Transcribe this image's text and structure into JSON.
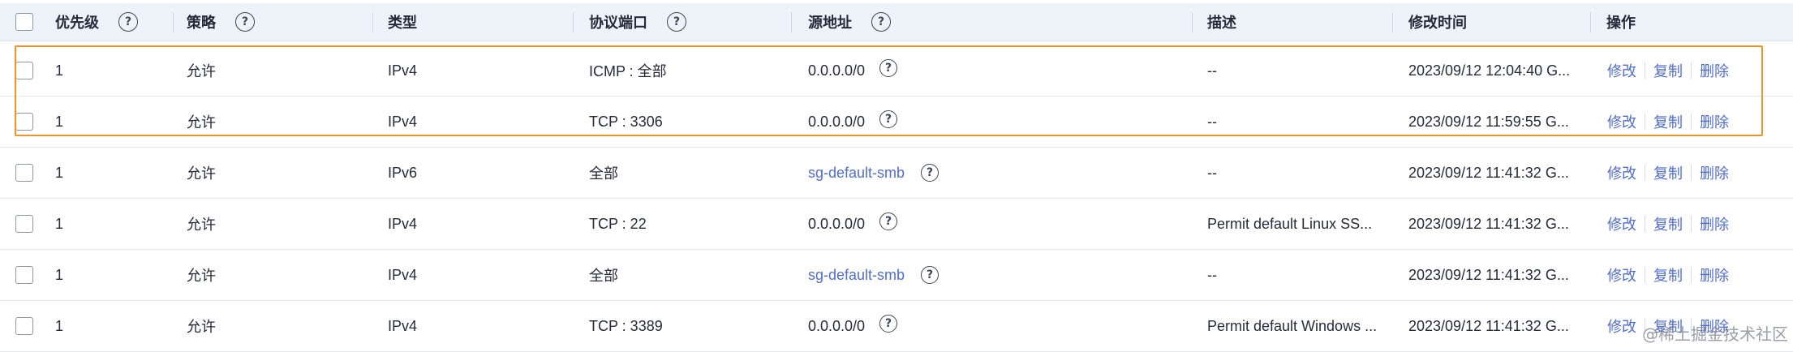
{
  "header": {
    "priority": "优先级",
    "policy": "策略",
    "type": "类型",
    "protocol_port": "协议端口",
    "source": "源地址",
    "description": "描述",
    "modified": "修改时间",
    "actions": "操作",
    "help_glyph": "?"
  },
  "rows": [
    {
      "priority": "1",
      "policy": "允许",
      "type": "IPv4",
      "protocol_port": "ICMP : 全部",
      "source": "0.0.0.0/0",
      "source_is_link": false,
      "source_has_help": true,
      "description": "--",
      "modified": "2023/09/12 12:04:40 G...",
      "action_edit": "修改",
      "action_copy": "复制",
      "action_delete": "删除"
    },
    {
      "priority": "1",
      "policy": "允许",
      "type": "IPv4",
      "protocol_port": "TCP : 3306",
      "source": "0.0.0.0/0",
      "source_is_link": false,
      "source_has_help": true,
      "description": "--",
      "modified": "2023/09/12 11:59:55 G...",
      "action_edit": "修改",
      "action_copy": "复制",
      "action_delete": "删除"
    },
    {
      "priority": "1",
      "policy": "允许",
      "type": "IPv6",
      "protocol_port": "全部",
      "source": "sg-default-smb",
      "source_is_link": true,
      "source_has_help": true,
      "description": "--",
      "modified": "2023/09/12 11:41:32 G...",
      "action_edit": "修改",
      "action_copy": "复制",
      "action_delete": "删除"
    },
    {
      "priority": "1",
      "policy": "允许",
      "type": "IPv4",
      "protocol_port": "TCP : 22",
      "source": "0.0.0.0/0",
      "source_is_link": false,
      "source_has_help": true,
      "description": "Permit default Linux SS...",
      "modified": "2023/09/12 11:41:32 G...",
      "action_edit": "修改",
      "action_copy": "复制",
      "action_delete": "删除"
    },
    {
      "priority": "1",
      "policy": "允许",
      "type": "IPv4",
      "protocol_port": "全部",
      "source": "sg-default-smb",
      "source_is_link": true,
      "source_has_help": true,
      "description": "--",
      "modified": "2023/09/12 11:41:32 G...",
      "action_edit": "修改",
      "action_copy": "复制",
      "action_delete": "删除"
    },
    {
      "priority": "1",
      "policy": "允许",
      "type": "IPv4",
      "protocol_port": "TCP : 3389",
      "source": "0.0.0.0/0",
      "source_is_link": false,
      "source_has_help": true,
      "description": "Permit default Windows ...",
      "modified": "2023/09/12 11:41:32 G...",
      "action_edit": "修改",
      "action_copy": "复制",
      "action_delete": "删除"
    }
  ],
  "highlight": {
    "color": "#f0932b",
    "rows": [
      0,
      1
    ]
  },
  "colors": {
    "link": "#526ecc",
    "header_bg": "#eef2f9",
    "highlight_border": "#f0932b"
  },
  "watermark": "@稀土掘金技术社区"
}
